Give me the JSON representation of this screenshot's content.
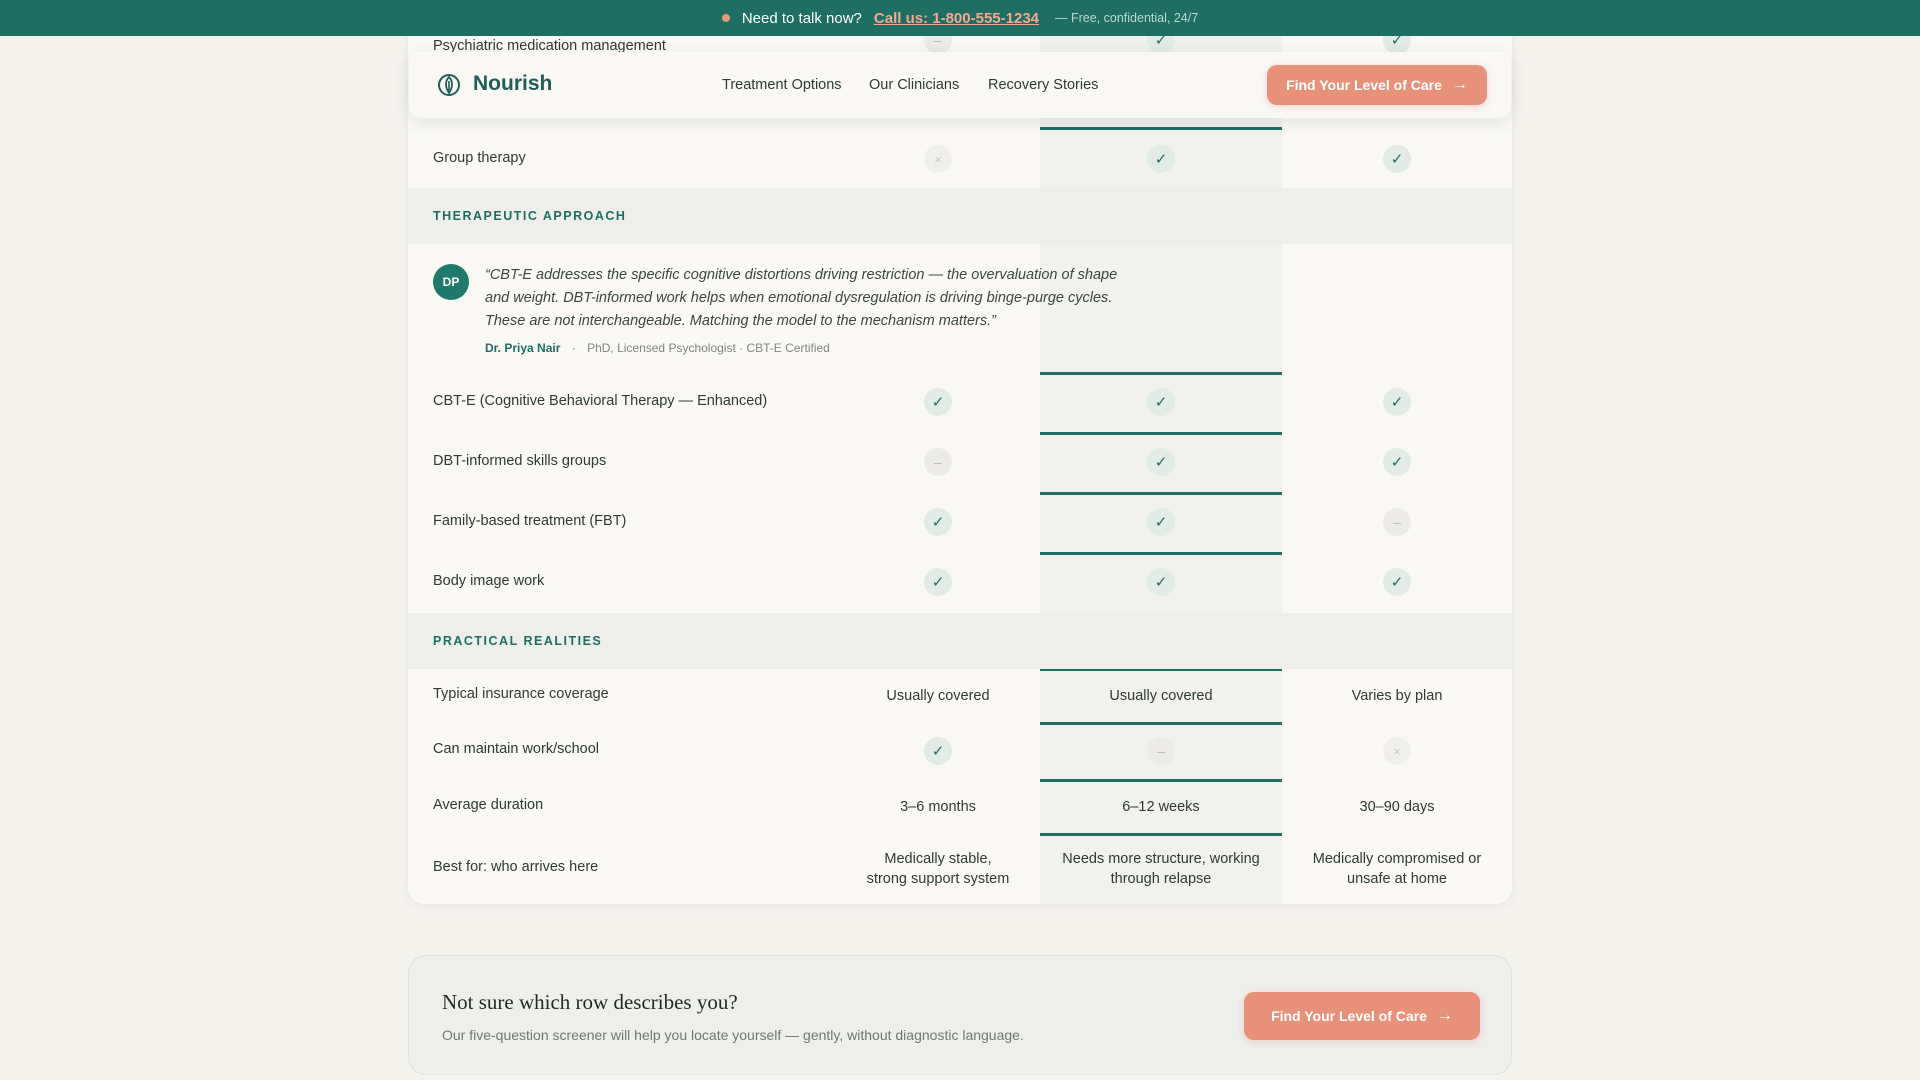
{
  "topbar": {
    "prompt": "Need to talk now?",
    "call": "Call us: 1-800-555-1234",
    "note": "— Free, confidential, 24/7"
  },
  "nav": {
    "brand": "Nourish",
    "links": [
      "Treatment Options",
      "Our Clinicians",
      "Recovery Stories"
    ],
    "cta_label": "Find Your Level of Care"
  },
  "table": {
    "partial_row": {
      "label": "Psychiatric medication management",
      "values": [
        "dash",
        "check",
        "check"
      ]
    },
    "group_therapy": {
      "label": "Group therapy",
      "values": [
        "cross",
        "check",
        "check"
      ]
    },
    "sections": {
      "therapeutic": "THERAPEUTIC APPROACH",
      "practical": "PRACTICAL REALITIES"
    },
    "quote": {
      "initials": "DP",
      "text": "“CBT-E addresses the specific cognitive distortions driving restriction — the overvaluation of shape and weight. DBT-informed work helps when emotional dysregulation is driving binge-purge cycles. These are not interchangeable. Matching the model to the mechanism matters.”",
      "author": "Dr. Priya Nair",
      "credentials": "PhD, Licensed Psychologist · CBT-E Certified"
    },
    "therapy_rows": [
      {
        "label": "CBT-E (Cognitive Behavioral Therapy — Enhanced)",
        "values": [
          "check",
          "check",
          "check"
        ]
      },
      {
        "label": "DBT-informed skills groups",
        "values": [
          "dash",
          "check",
          "check"
        ]
      },
      {
        "label": "Family-based treatment (FBT)",
        "values": [
          "check",
          "check",
          "dash"
        ]
      },
      {
        "label": "Body image work",
        "values": [
          "check",
          "check",
          "check"
        ]
      }
    ],
    "practical_rows": {
      "insurance": {
        "label": "Typical insurance coverage",
        "values": [
          "Usually covered",
          "Usually covered",
          "Varies by plan"
        ]
      },
      "work": {
        "label": "Can maintain work/school",
        "values": [
          "check",
          "dash",
          "cross"
        ]
      },
      "duration": {
        "label": "Average duration",
        "values": [
          "3–6 months",
          "6–12 weeks",
          "30–90 days"
        ]
      },
      "best_for": {
        "label": "Best for: who arrives here",
        "values": [
          "Medically stable, strong support system",
          "Needs more structure, working through relapse",
          "Medically compromised or unsafe at home"
        ]
      }
    },
    "icons": {
      "check": "✓",
      "dash": "–",
      "cross": "×"
    }
  },
  "cta": {
    "title": "Not sure which row describes you?",
    "subtitle": "Our five-question screener will help you locate yourself — gently, without diagnostic language.",
    "button_label": "Find Your Level of Care"
  },
  "colors": {
    "brand": "#1f6e63",
    "accent": "#e8917a",
    "background": "#f5f3ee"
  }
}
